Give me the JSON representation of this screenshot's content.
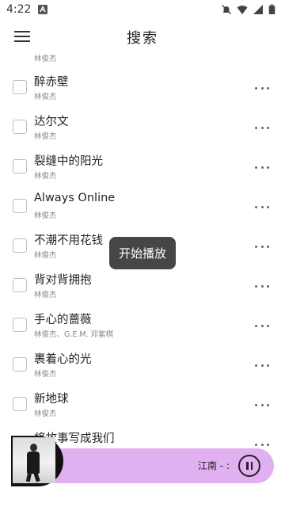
{
  "status_bar": {
    "time": "4:22",
    "icons": [
      "notification-app-icon",
      "notifications-off-icon",
      "wifi-icon",
      "signal-icon",
      "battery-icon"
    ]
  },
  "header": {
    "title": "搜索",
    "menu_icon": "hamburger-menu-icon"
  },
  "partial_top_row": {
    "artist": "林俊杰"
  },
  "songs": [
    {
      "title": "醉赤壁",
      "artist": "林俊杰"
    },
    {
      "title": "达尔文",
      "artist": "林俊杰"
    },
    {
      "title": "裂缝中的阳光",
      "artist": "林俊杰"
    },
    {
      "title": "Always Online",
      "artist": "林俊杰"
    },
    {
      "title": "不潮不用花钱",
      "artist": "林俊杰"
    },
    {
      "title": "背对背拥抱",
      "artist": "林俊杰"
    },
    {
      "title": "手心的蔷薇",
      "artist": "林俊杰、G.E.M. 邓紫棋"
    },
    {
      "title": "裹着心的光",
      "artist": "林俊杰"
    },
    {
      "title": "新地球",
      "artist": "林俊杰"
    },
    {
      "title": "将故事写成我们",
      "artist": ""
    }
  ],
  "toast": {
    "text": "开始播放"
  },
  "player": {
    "now_playing": "江南 - :",
    "pause_icon": "pause-icon",
    "colors": {
      "bar": "#e0b0f0"
    }
  }
}
